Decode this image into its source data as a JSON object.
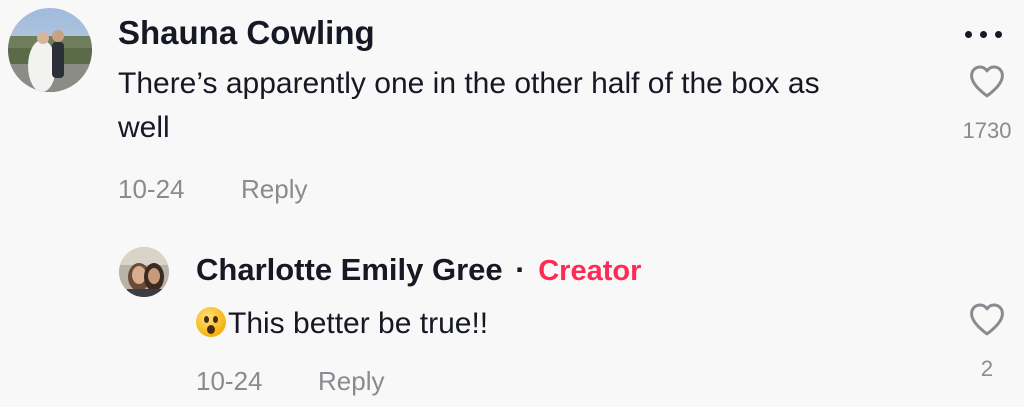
{
  "comments": [
    {
      "author": "Shauna Cowling",
      "text_line1": "There’s apparently one in the other half of the box as",
      "text_line2": "well",
      "date": "10-24",
      "reply_label": "Reply",
      "like_count": "1730",
      "more_icon": "more-horizontal-icon",
      "like_icon": "heart-outline-icon"
    }
  ],
  "replies": [
    {
      "author": "Charlotte Emily Gree",
      "separator": "·",
      "badge": "Creator",
      "emoji_icon": "astonished-face-emoji",
      "text": "This better be true!!",
      "date": "10-24",
      "reply_label": "Reply",
      "like_count": "2",
      "like_icon": "heart-outline-icon"
    }
  ],
  "colors": {
    "background": "#f8f8f8",
    "text_primary": "#161823",
    "text_secondary": "#8a8b91",
    "creator_badge": "#fe2c55"
  }
}
